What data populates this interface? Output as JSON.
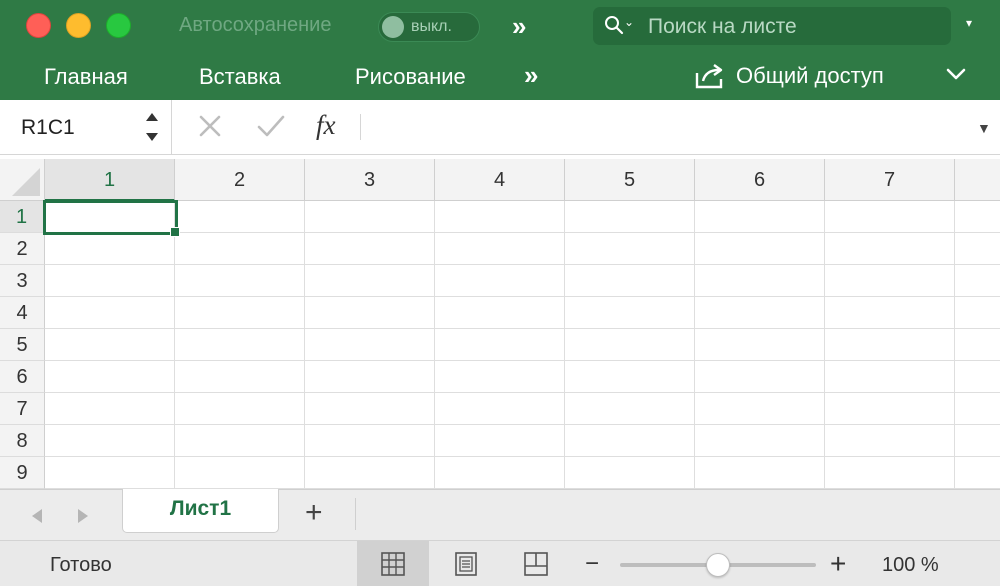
{
  "window": {
    "autosave_label": "Автосохранение",
    "autosave_toggle": "выкл.",
    "more_commands": "»",
    "search_placeholder": "Поиск на листе",
    "colors": {
      "ribbon": "#2f7a45",
      "accent": "#217346"
    }
  },
  "ribbon": {
    "tabs": [
      {
        "label": "Главная"
      },
      {
        "label": "Вставка"
      },
      {
        "label": "Рисование"
      }
    ],
    "more_tabs": "»",
    "share_label": "Общий доступ"
  },
  "formula_bar": {
    "name_box": "R1C1",
    "fx_label": "fx",
    "value": ""
  },
  "grid": {
    "columns": [
      "1",
      "2",
      "3",
      "4",
      "5",
      "6",
      "7"
    ],
    "rows": [
      "1",
      "2",
      "3",
      "4",
      "5",
      "6",
      "7",
      "8",
      "9"
    ],
    "selected": {
      "row": "1",
      "column": "1"
    }
  },
  "sheets": {
    "tabs": [
      {
        "label": "Лист1",
        "active": true
      }
    ],
    "add_label": "+"
  },
  "status": {
    "text": "Готово",
    "zoom_minus": "−",
    "zoom_plus": "+",
    "zoom_label": "100 %",
    "zoom_fraction": 0.5
  }
}
